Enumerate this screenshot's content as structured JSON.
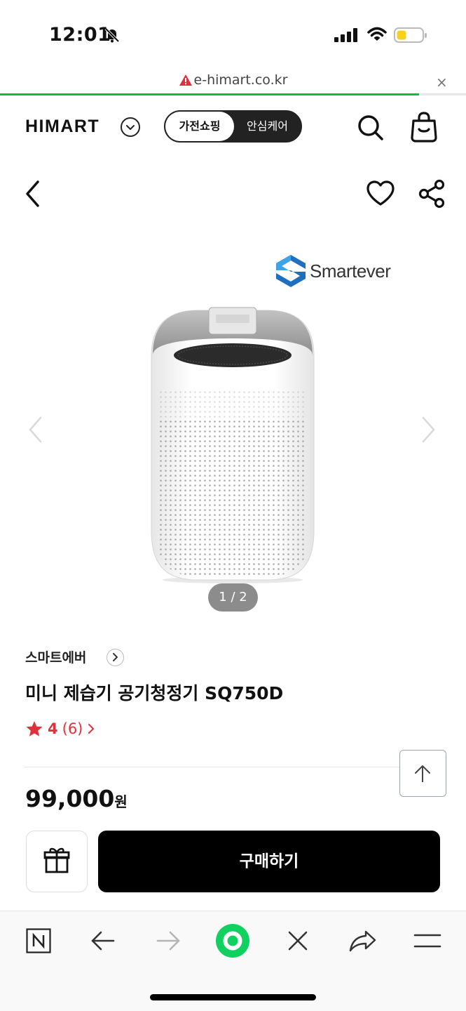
{
  "status_bar": {
    "time": "12:01"
  },
  "url_bar": {
    "domain": "e-himart.co.kr",
    "close": "×"
  },
  "header": {
    "logo": "HIMART",
    "tab_shopping": "가전쇼핑",
    "tab_care": "안심케어"
  },
  "product": {
    "image_brand_logo": "Smartever",
    "image_pager": "1 / 2",
    "brand": "스마트에버",
    "title": "미니 제습기 공기청정기 SQ750D",
    "rating_score": "4",
    "rating_count": "(6)",
    "price": "99,000",
    "price_unit": "원"
  },
  "actions": {
    "buy_label": "구매하기"
  },
  "colors": {
    "accent_red": "#e0303b",
    "progress_green": "#1bb34a",
    "home_green": "#10d060"
  }
}
